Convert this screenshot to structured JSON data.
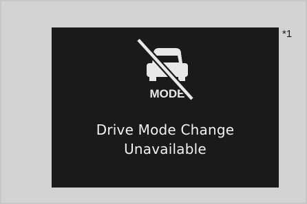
{
  "display": {
    "icon_label": "MODE",
    "message_line1": "Drive Mode Change",
    "message_line2": "Unavailable"
  },
  "footnote": "*1",
  "icons": {
    "mode_unavailable": "car-front-crossed-out-icon"
  },
  "colors": {
    "outer_background": "#d3d3d3",
    "outer_border": "#c6c6c6",
    "screen_background": "#1a1a1a",
    "screen_text": "#f2f2f2"
  }
}
